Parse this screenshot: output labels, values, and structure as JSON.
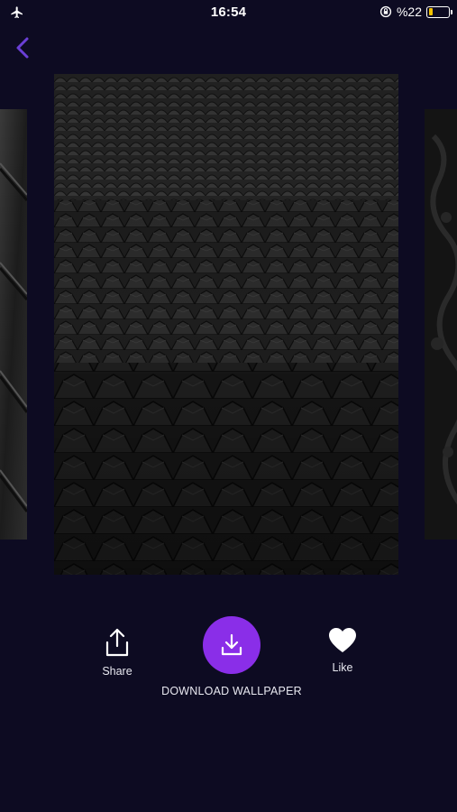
{
  "status_bar": {
    "time": "16:54",
    "battery_percent": "%22",
    "battery_level": 0.22,
    "left_icon": "airplane-icon",
    "right_icon": "rotation-lock-icon"
  },
  "nav": {
    "back_icon": "chevron-left-icon",
    "accent_color": "#6a3fd6"
  },
  "wallpapers": {
    "previous": "dark-geometric-panels-thumbnail",
    "current": "black-scale-texture-wallpaper",
    "next": "dark-ornate-relief-thumbnail"
  },
  "actions": {
    "share_label": "Share",
    "download_label": "DOWNLOAD WALLPAPER",
    "like_label": "Like",
    "download_color": "#8a2ee8",
    "share_icon": "share-icon",
    "download_icon": "download-icon",
    "like_icon": "heart-icon"
  }
}
